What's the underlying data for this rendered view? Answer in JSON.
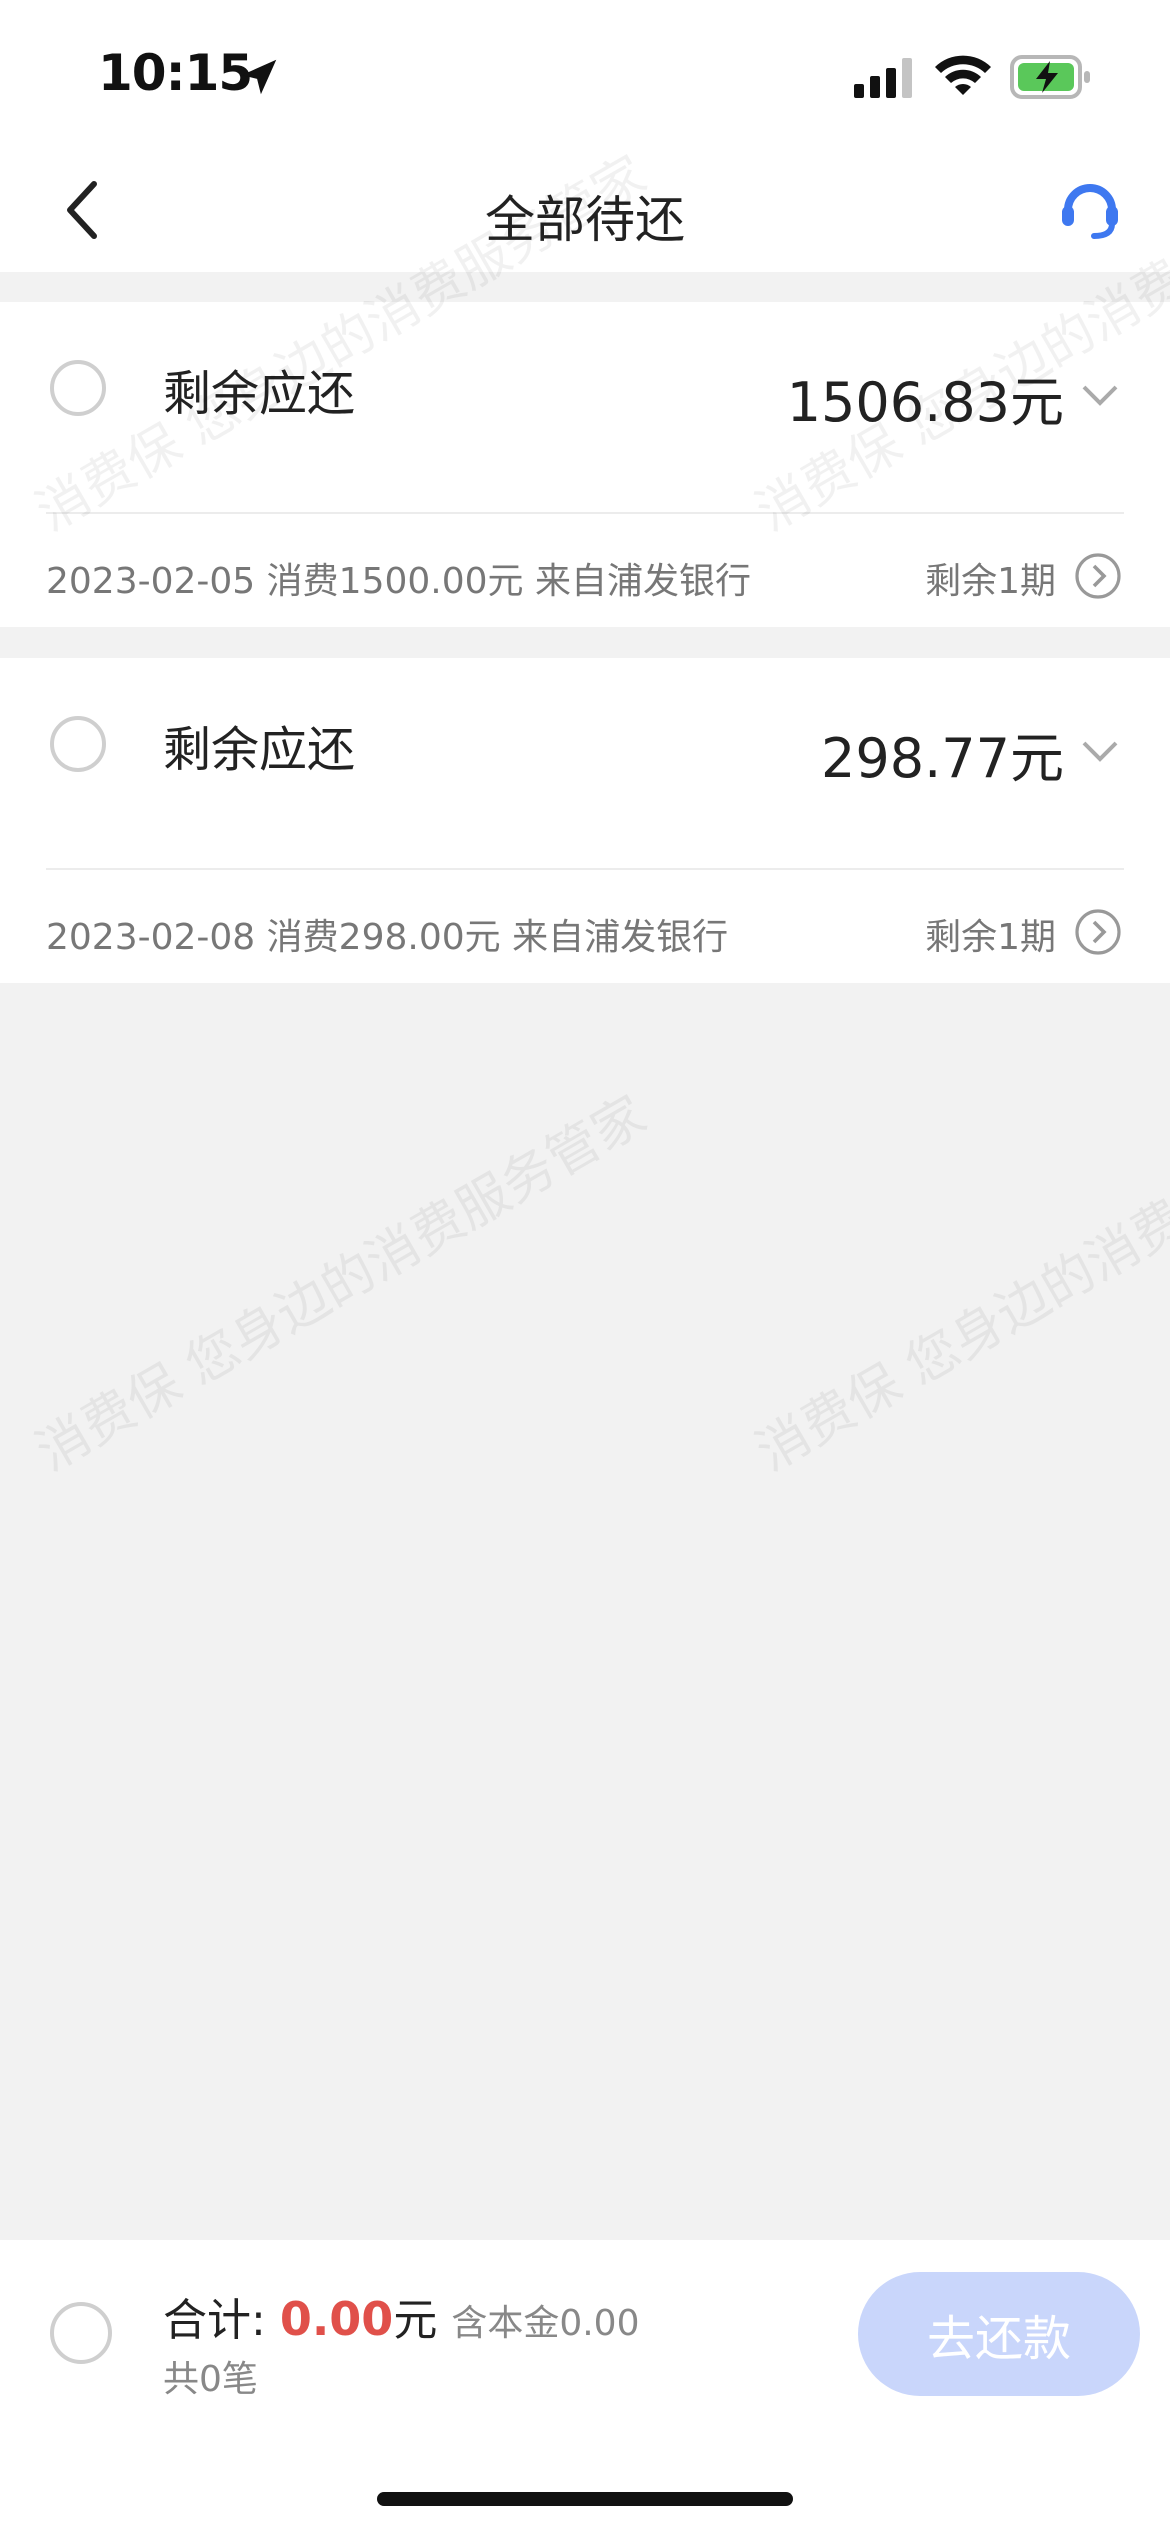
{
  "status_bar": {
    "time": "10:15"
  },
  "nav": {
    "title": "全部待还"
  },
  "loans": [
    {
      "label": "剩余应还",
      "amount": "1506.83元",
      "detail": "2023-02-05 消费1500.00元  来自浦发银行",
      "periods": "剩余1期"
    },
    {
      "label": "剩余应还",
      "amount": "298.77元",
      "detail": "2023-02-08 消费298.00元  来自浦发银行",
      "periods": "剩余1期"
    }
  ],
  "footer": {
    "total_label": "合计: ",
    "total_value": "0.00",
    "total_unit": "元",
    "principal": "含本金0.00",
    "count": "共0笔",
    "pay_button": "去还款"
  },
  "watermark": "消费保 您身边的消费服务管家",
  "colors": {
    "accent_red": "#e0504a",
    "button_disabled": "#c9d6fb",
    "icon_blue": "#3e78f0"
  }
}
